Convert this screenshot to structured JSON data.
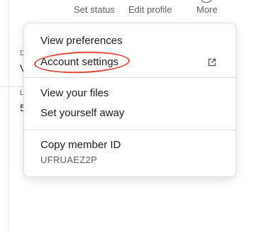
{
  "background": {
    "fragment_1": "D",
    "fragment_2": "V",
    "fragment_3": "L",
    "fragment_4": "5"
  },
  "top_actions": {
    "set_status": "Set status",
    "edit_profile": "Edit profile",
    "more": "More"
  },
  "menu": {
    "items": [
      {
        "label": "View preferences"
      },
      {
        "label": "Account settings",
        "icon": "external-link-icon"
      },
      {
        "label": "View your files"
      },
      {
        "label": "Set yourself away"
      },
      {
        "label": "Copy member ID"
      }
    ],
    "member_id": "UFRUAEZ2P"
  },
  "colors": {
    "highlight": "#e8443a",
    "text": "#1d1c1d",
    "muted": "#616061",
    "border": "#dddddd"
  }
}
